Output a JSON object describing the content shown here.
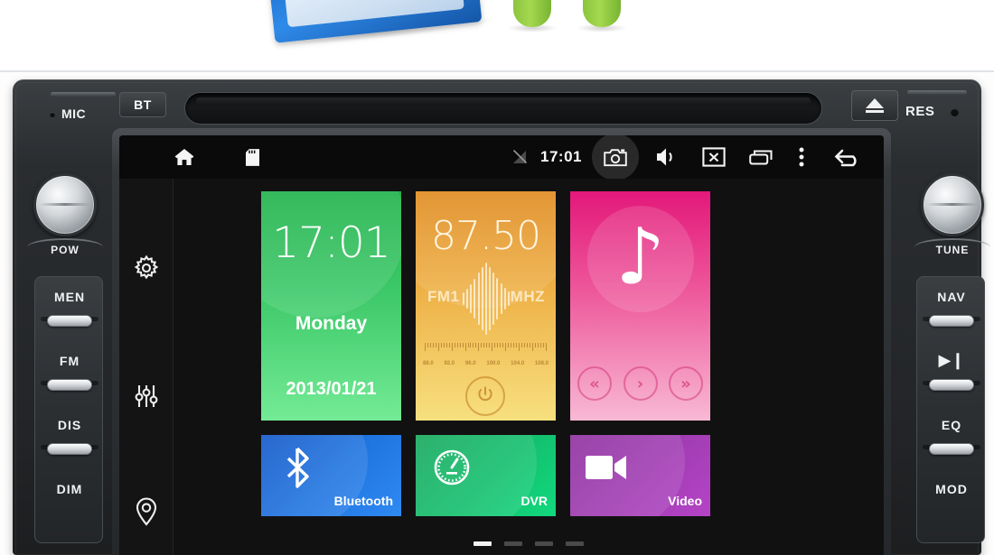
{
  "product_photo": {
    "package_label": "retail-package-box",
    "mascot_label": "android-robot-legs"
  },
  "faceplate": {
    "mic_label": "MIC",
    "bt_button": "BT",
    "res_label": "RES",
    "eject_icon": "eject-icon",
    "disc_slot": "disc-slot",
    "knob_left_label": "POW",
    "knob_right_label": "TUNE",
    "left_buttons": [
      "MEN",
      "FM",
      "DIS",
      "DIM"
    ],
    "right_buttons": [
      "NAV",
      "▶❙",
      "EQ",
      "MOD"
    ]
  },
  "statusbar": {
    "home_icon": "home-icon",
    "sdcard_icon": "sd-card-icon",
    "signal_icon": "signal-off-icon",
    "time": "17:01",
    "camera_icon": "camera-icon",
    "volume_icon": "volume-icon",
    "screenoff_icon": "screen-off-icon",
    "recents_icon": "recent-apps-icon",
    "overflow_icon": "overflow-menu-icon",
    "back_icon": "back-icon"
  },
  "sidebar": {
    "items": [
      {
        "name": "settings",
        "icon": "gear-icon"
      },
      {
        "name": "equalizer",
        "icon": "equalizer-icon"
      },
      {
        "name": "navigation",
        "icon": "location-pin-icon"
      }
    ]
  },
  "tiles": {
    "clock": {
      "time": "17:01",
      "day": "Monday",
      "date": "2013/01/21",
      "color": "#3ec96a"
    },
    "radio": {
      "frequency": "87.50",
      "band": "FM1",
      "unit": "MHZ",
      "color": "#eeb046",
      "power_icon": "power-icon",
      "scale_labels": [
        "88.0",
        "92.0",
        "96.0",
        "100.0",
        "104.0",
        "108.0"
      ]
    },
    "music": {
      "note_glyph": "♪",
      "color": "#ee5a9c",
      "prev_label": "«",
      "play_label": "›",
      "next_label": "»"
    },
    "bluetooth": {
      "label": "Bluetooth",
      "icon": "bluetooth-icon",
      "color": "#1f74e0"
    },
    "dvr": {
      "label": "DVR",
      "icon": "speedometer-icon",
      "color": "#13bd6c"
    },
    "video": {
      "label": "Video",
      "icon": "video-camera-icon",
      "color": "#a03cb2"
    }
  },
  "pager": {
    "pages": 4,
    "active": 1
  }
}
